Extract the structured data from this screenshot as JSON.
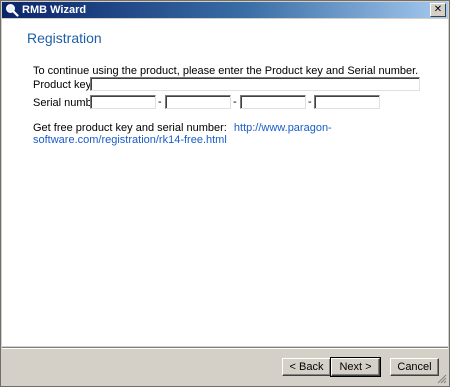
{
  "window": {
    "title": "RMB Wizard",
    "close_glyph": "✕"
  },
  "page": {
    "heading": "Registration",
    "instruction": "To continue using the product, please enter the Product key and Serial number.",
    "product_key_label": "Product key:",
    "product_key_value": "",
    "serial_label": "Serial number:",
    "serial_parts": [
      "",
      "",
      "",
      ""
    ],
    "serial_separator": "-",
    "get_free_text": "Get free product key and serial number:",
    "get_free_link": "http://www.paragon-software.com/registration/rk14-free.html"
  },
  "buttons": {
    "back": "< Back",
    "next": "Next >",
    "cancel": "Cancel"
  },
  "icons": {
    "title_icon": "magnifier-icon",
    "resize": "resize-grip-icon"
  },
  "colors": {
    "heading": "#1f5fa8",
    "link": "#1a5cc8",
    "titlebar_start": "#0a246a",
    "titlebar_end": "#a6caf0"
  }
}
